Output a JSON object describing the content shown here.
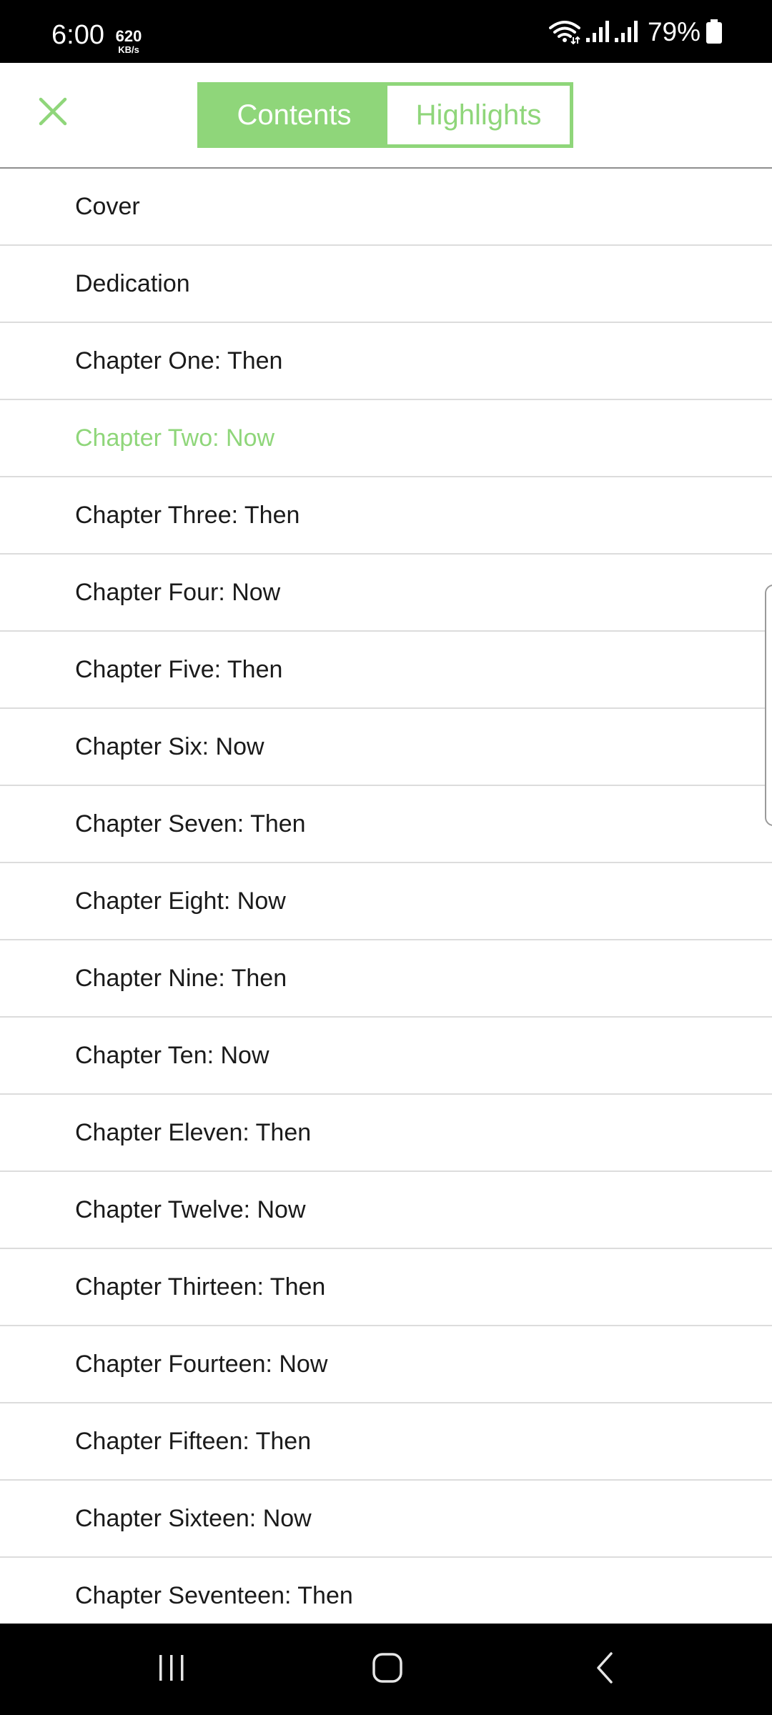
{
  "status_bar": {
    "time": "6:00",
    "net_speed": "620",
    "net_speed_unit": "KB/s",
    "battery": "79%",
    "icons": [
      "wifi-icon",
      "signal-icon",
      "signal-icon",
      "battery-icon"
    ]
  },
  "header": {
    "close_icon": "close-icon",
    "tabs": [
      {
        "label": "Contents",
        "active": true
      },
      {
        "label": "Highlights",
        "active": false
      }
    ]
  },
  "toc": {
    "items": [
      {
        "label": "Cover"
      },
      {
        "label": "Dedication"
      },
      {
        "label": "Chapter One: Then"
      },
      {
        "label": "Chapter Two: Now",
        "current": true
      },
      {
        "label": "Chapter Three: Then"
      },
      {
        "label": "Chapter Four: Now"
      },
      {
        "label": "Chapter Five: Then"
      },
      {
        "label": "Chapter Six: Now"
      },
      {
        "label": "Chapter Seven: Then"
      },
      {
        "label": "Chapter Eight: Now"
      },
      {
        "label": "Chapter Nine: Then"
      },
      {
        "label": "Chapter Ten: Now"
      },
      {
        "label": "Chapter Eleven: Then"
      },
      {
        "label": "Chapter Twelve: Now"
      },
      {
        "label": "Chapter Thirteen: Then"
      },
      {
        "label": "Chapter Fourteen: Now"
      },
      {
        "label": "Chapter Fifteen: Then"
      },
      {
        "label": "Chapter Sixteen: Now"
      },
      {
        "label": "Chapter Seventeen: Then"
      }
    ]
  },
  "nav_bar": {
    "icons": [
      "recent-apps-icon",
      "home-icon",
      "back-icon"
    ]
  },
  "colors": {
    "accent": "#8fd67a",
    "text": "#1a1a1a",
    "divider": "#dcdcdc",
    "system_bar": "#000000"
  }
}
